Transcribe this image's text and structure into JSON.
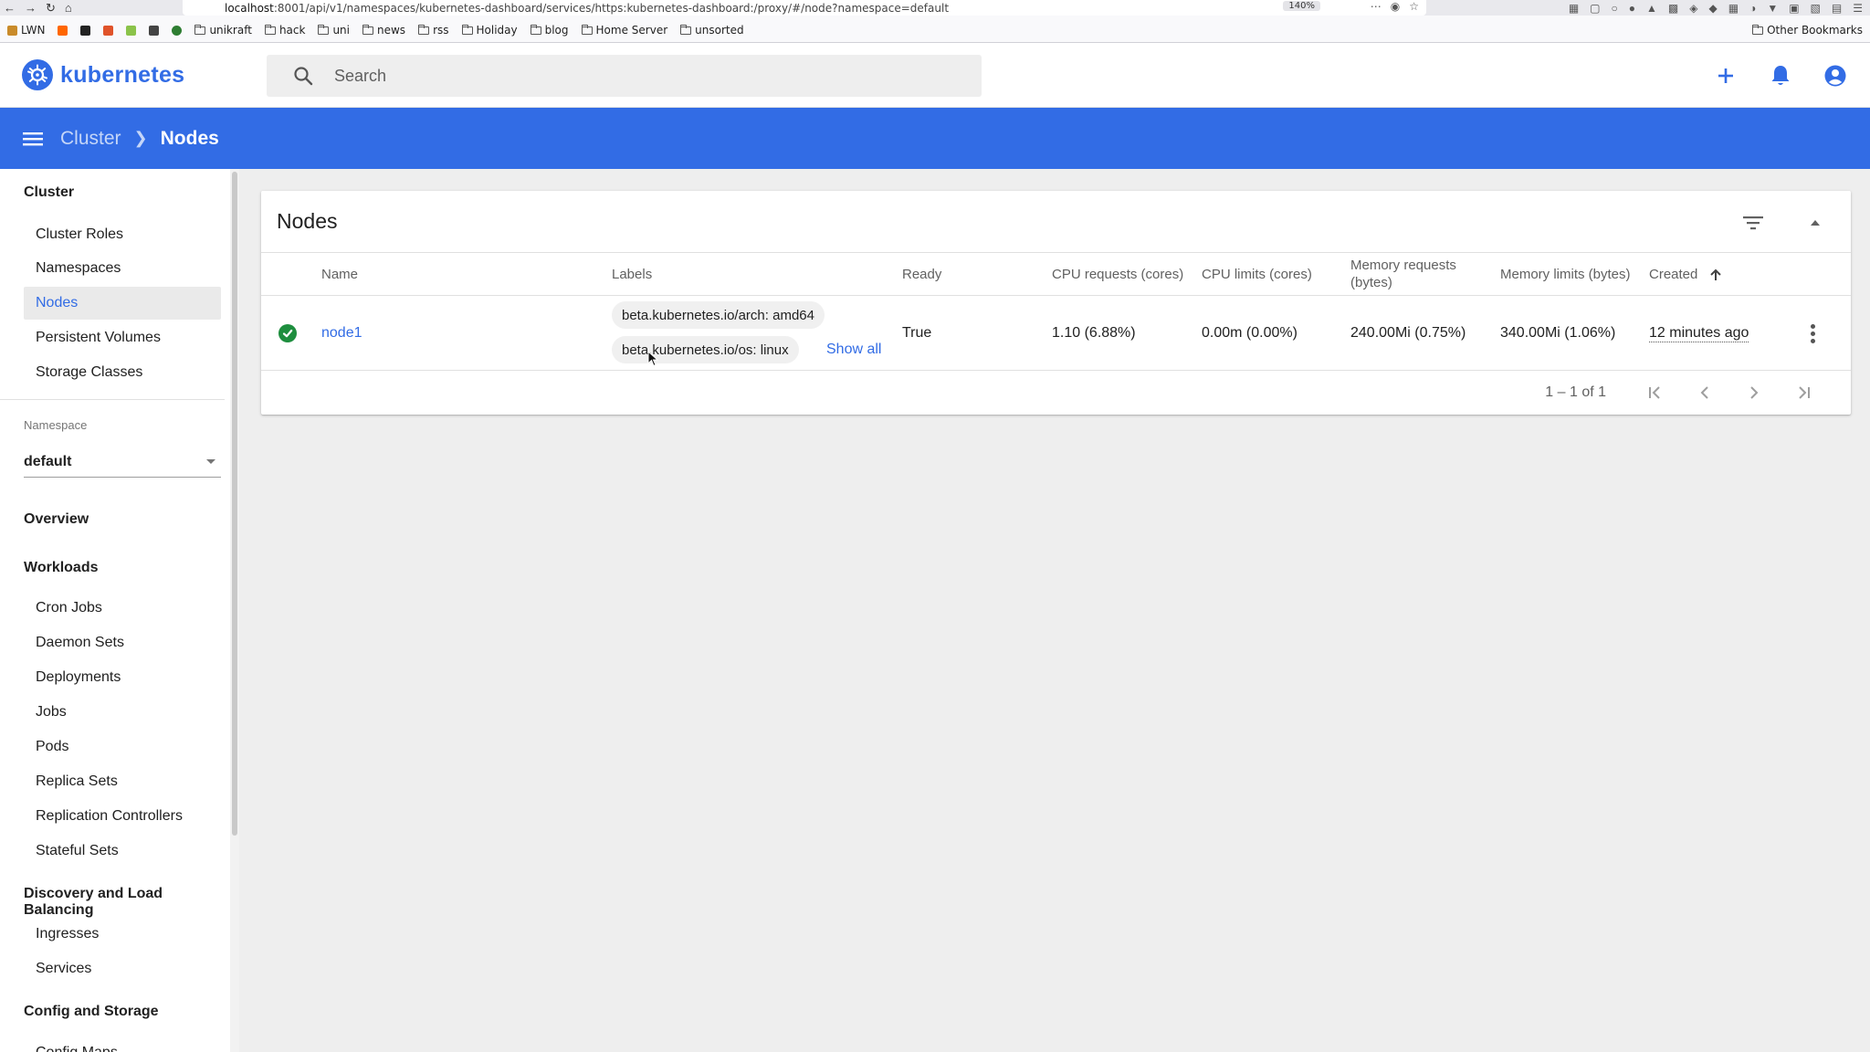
{
  "browser": {
    "url_host": "localhost",
    "url_path": ":8001/api/v1/namespaces/kubernetes-dashboard/services/https:kubernetes-dashboard:/proxy/#/node?namespace=default",
    "zoom": "140%",
    "bookmarks": [
      "LWN",
      "unikraft",
      "hack",
      "uni",
      "news",
      "rss",
      "Holiday",
      "blog",
      "Home Server",
      "unsorted"
    ],
    "other_bookmarks": "Other Bookmarks"
  },
  "header": {
    "logo_text": "kubernetes",
    "search_placeholder": "Search"
  },
  "breadcrumb": {
    "parent": "Cluster",
    "current": "Nodes"
  },
  "sidebar": {
    "cluster": {
      "title": "Cluster",
      "items": [
        "Cluster Roles",
        "Namespaces",
        "Nodes",
        "Persistent Volumes",
        "Storage Classes"
      ],
      "active": "Nodes"
    },
    "namespace_caption": "Namespace",
    "namespace_value": "default",
    "overview": "Overview",
    "workloads": {
      "title": "Workloads",
      "items": [
        "Cron Jobs",
        "Daemon Sets",
        "Deployments",
        "Jobs",
        "Pods",
        "Replica Sets",
        "Replication Controllers",
        "Stateful Sets"
      ]
    },
    "discovery": {
      "title": "Discovery and Load Balancing",
      "items": [
        "Ingresses",
        "Services"
      ]
    },
    "config": {
      "title": "Config and Storage",
      "items": [
        "Config Maps"
      ]
    }
  },
  "nodes_card": {
    "title": "Nodes",
    "columns": {
      "name": "Name",
      "labels": "Labels",
      "ready": "Ready",
      "cpu_requests": "CPU requests (cores)",
      "cpu_limits": "CPU limits (cores)",
      "memory_requests_1": "Memory requests",
      "memory_requests_2": "(bytes)",
      "memory_limits": "Memory limits (bytes)",
      "created": "Created"
    },
    "rows": [
      {
        "name": "node1",
        "labels": [
          "beta.kubernetes.io/arch: amd64",
          "beta.kubernetes.io/os: linux"
        ],
        "show_all": "Show all",
        "ready": "True",
        "cpu_requests": "1.10 (6.88%)",
        "cpu_limits": "0.00m (0.00%)",
        "memory_requests": "240.00Mi (0.75%)",
        "memory_limits": "340.00Mi (1.06%)",
        "created": "12 minutes ago"
      }
    ],
    "range_label": "1 – 1 of 1"
  },
  "colors": {
    "brand": "#326ce5",
    "success": "#1e8e3e"
  }
}
